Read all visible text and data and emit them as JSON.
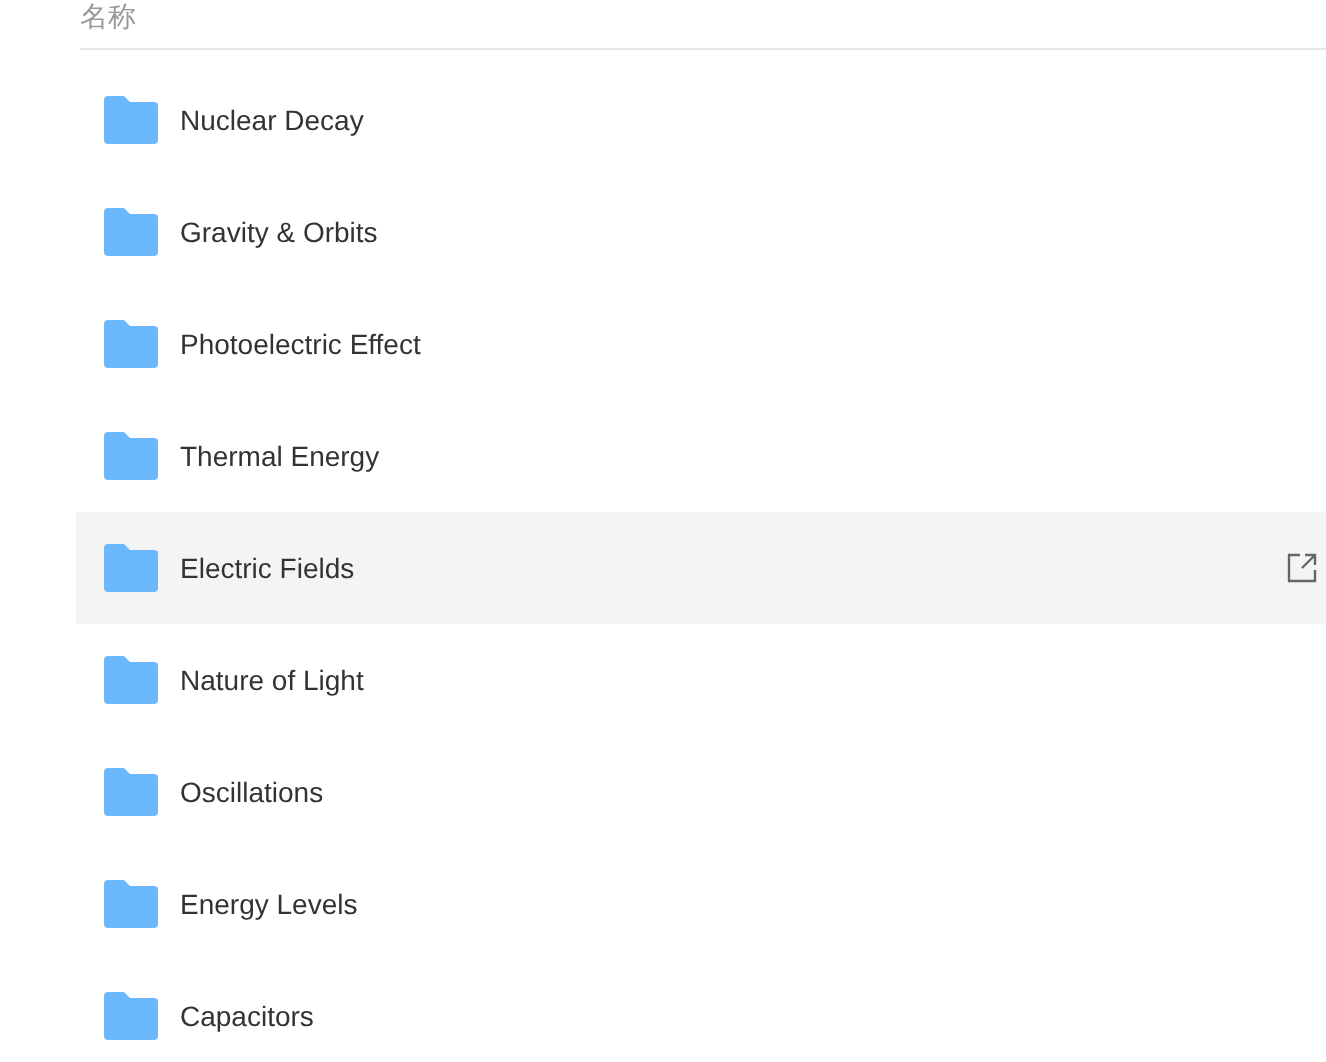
{
  "table": {
    "columns": [
      {
        "label": "名称"
      }
    ],
    "rows": [
      {
        "name": "Nuclear Decay",
        "highlighted": false
      },
      {
        "name": "Gravity & Orbits",
        "highlighted": false
      },
      {
        "name": "Photoelectric Effect",
        "highlighted": false
      },
      {
        "name": "Thermal Energy",
        "highlighted": false
      },
      {
        "name": "Electric Fields",
        "highlighted": true
      },
      {
        "name": "Nature of Light",
        "highlighted": false
      },
      {
        "name": "Oscillations",
        "highlighted": false
      },
      {
        "name": "Energy Levels",
        "highlighted": false
      },
      {
        "name": "Capacitors",
        "highlighted": false
      }
    ]
  }
}
